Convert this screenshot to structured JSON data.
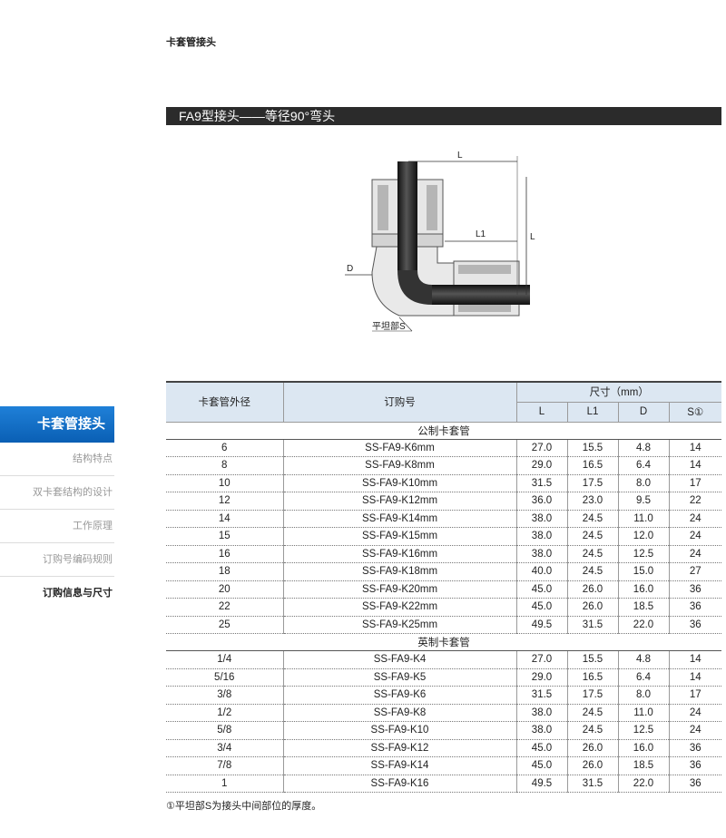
{
  "header": {
    "category": "卡套管接头"
  },
  "section": {
    "title": "FA9型接头——等径90°弯头"
  },
  "diagram": {
    "labels": {
      "L": "L",
      "L1": "L1",
      "L_vertical": "L",
      "D": "D",
      "S": "平坦部S"
    }
  },
  "sidebar": {
    "active": "卡套管接头",
    "items": [
      {
        "label": "结构特点"
      },
      {
        "label": "双卡套结构的设计"
      },
      {
        "label": "工作原理"
      },
      {
        "label": "订购号编码规则"
      },
      {
        "label": "订购信息与尺寸"
      }
    ]
  },
  "table": {
    "headers": {
      "od": "卡套管外径",
      "order": "订购号",
      "dims": "尺寸（mm）",
      "L": "L",
      "L1": "L1",
      "D": "D",
      "S": "S①"
    },
    "groups": [
      {
        "title": "公制卡套管",
        "rows": [
          [
            "6",
            "SS-FA9-K6mm",
            "27.0",
            "15.5",
            "4.8",
            "14"
          ],
          [
            "8",
            "SS-FA9-K8mm",
            "29.0",
            "16.5",
            "6.4",
            "14"
          ],
          [
            "10",
            "SS-FA9-K10mm",
            "31.5",
            "17.5",
            "8.0",
            "17"
          ],
          [
            "12",
            "SS-FA9-K12mm",
            "36.0",
            "23.0",
            "9.5",
            "22"
          ],
          [
            "14",
            "SS-FA9-K14mm",
            "38.0",
            "24.5",
            "11.0",
            "24"
          ],
          [
            "15",
            "SS-FA9-K15mm",
            "38.0",
            "24.5",
            "12.0",
            "24"
          ],
          [
            "16",
            "SS-FA9-K16mm",
            "38.0",
            "24.5",
            "12.5",
            "24"
          ],
          [
            "18",
            "SS-FA9-K18mm",
            "40.0",
            "24.5",
            "15.0",
            "27"
          ],
          [
            "20",
            "SS-FA9-K20mm",
            "45.0",
            "26.0",
            "16.0",
            "36"
          ],
          [
            "22",
            "SS-FA9-K22mm",
            "45.0",
            "26.0",
            "18.5",
            "36"
          ],
          [
            "25",
            "SS-FA9-K25mm",
            "49.5",
            "31.5",
            "22.0",
            "36"
          ]
        ]
      },
      {
        "title": "英制卡套管",
        "rows": [
          [
            "1/4",
            "SS-FA9-K4",
            "27.0",
            "15.5",
            "4.8",
            "14"
          ],
          [
            "5/16",
            "SS-FA9-K5",
            "29.0",
            "16.5",
            "6.4",
            "14"
          ],
          [
            "3/8",
            "SS-FA9-K6",
            "31.5",
            "17.5",
            "8.0",
            "17"
          ],
          [
            "1/2",
            "SS-FA9-K8",
            "38.0",
            "24.5",
            "11.0",
            "24"
          ],
          [
            "5/8",
            "SS-FA9-K10",
            "38.0",
            "24.5",
            "12.5",
            "24"
          ],
          [
            "3/4",
            "SS-FA9-K12",
            "45.0",
            "26.0",
            "16.0",
            "36"
          ],
          [
            "7/8",
            "SS-FA9-K14",
            "45.0",
            "26.0",
            "18.5",
            "36"
          ],
          [
            "1",
            "SS-FA9-K16",
            "49.5",
            "31.5",
            "22.0",
            "36"
          ]
        ]
      }
    ]
  },
  "footnote": "①平坦部S为接头中间部位的厚度。"
}
